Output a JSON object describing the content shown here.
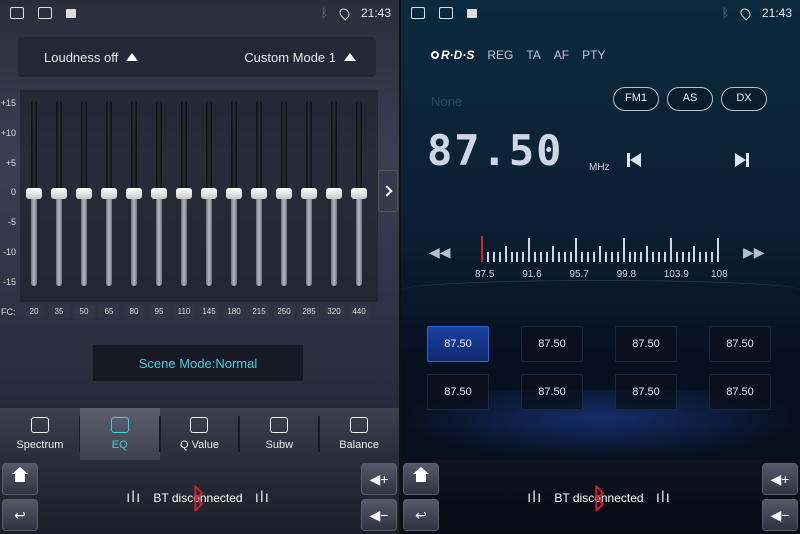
{
  "status": {
    "left": {
      "time": "21:43"
    },
    "right": {
      "time": "21:43"
    }
  },
  "eq": {
    "loudness_label": "Loudness off",
    "mode_label": "Custom Mode 1",
    "scale": [
      "+15",
      "+10",
      "+5",
      "0",
      "-5",
      "-10",
      "-15"
    ],
    "fc_title": "FC:",
    "bands": [
      {
        "fc": "20",
        "level": 0
      },
      {
        "fc": "35",
        "level": 0
      },
      {
        "fc": "50",
        "level": 0
      },
      {
        "fc": "65",
        "level": 0
      },
      {
        "fc": "80",
        "level": 0
      },
      {
        "fc": "95",
        "level": 0
      },
      {
        "fc": "110",
        "level": 0
      },
      {
        "fc": "145",
        "level": 0
      },
      {
        "fc": "180",
        "level": 0
      },
      {
        "fc": "215",
        "level": 0
      },
      {
        "fc": "250",
        "level": 0
      },
      {
        "fc": "285",
        "level": 0
      },
      {
        "fc": "320",
        "level": 0
      },
      {
        "fc": "440",
        "level": 0
      }
    ],
    "scene_label": "Scene Mode:Normal"
  },
  "tabs": [
    {
      "label": "Spectrum",
      "icon": "spectrum-icon",
      "active": false
    },
    {
      "label": "EQ",
      "icon": "eq-sliders-icon",
      "active": true
    },
    {
      "label": "Q Value",
      "icon": "q-value-icon",
      "active": false
    },
    {
      "label": "Subw",
      "icon": "subwoofer-icon",
      "active": false
    },
    {
      "label": "Balance",
      "icon": "balance-icon",
      "active": false
    }
  ],
  "bottom": {
    "bt_status": "BT disconnected",
    "volume_up": "◀+",
    "volume_down": "◀−"
  },
  "radio": {
    "rds_logo": "R·D·S",
    "rds_options": [
      "REG",
      "TA",
      "AF",
      "PTY"
    ],
    "station_name": "None",
    "frequency": "87.50",
    "unit": "MHz",
    "bands": [
      "FM1",
      "AS",
      "DX"
    ],
    "scale_labels": [
      "87.5",
      "91.6",
      "95.7",
      "99.8",
      "103.9",
      "108"
    ],
    "tuned_fraction": 0.0,
    "presets": [
      "87.50",
      "87.50",
      "87.50",
      "87.50",
      "87.50",
      "87.50",
      "87.50",
      "87.50"
    ],
    "active_preset": 0
  },
  "colors": {
    "accent_cyan": "#3ad0e6",
    "needle_red": "#d2242c",
    "preset_active": "#1b3fa0"
  }
}
